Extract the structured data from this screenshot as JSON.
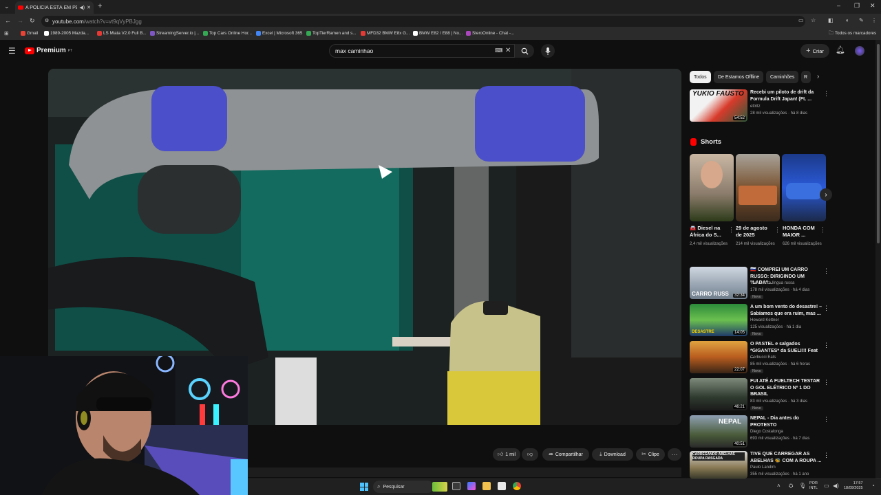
{
  "browser": {
    "tab_title": "A POLÍCIA ESTÁ EM PESO I",
    "url_host": "youtube.com",
    "url_path": "/watch?v=vt9qVyPBJgg",
    "bookmarks": [
      {
        "label": "Gmail",
        "color": "#ea4335"
      },
      {
        "label": "1989-2005 Mazda...",
        "color": "#ffffff"
      },
      {
        "label": "LS Miata V2.0 Full B...",
        "color": "#e53935"
      },
      {
        "label": "StreamingServer.io |...",
        "color": "#7e57c2"
      },
      {
        "label": "Top Cars Online Hor...",
        "color": "#34a853"
      },
      {
        "label": "Excel | Microsoft 365",
        "color": "#4285f4"
      },
      {
        "label": "TopTierRamen and s...",
        "color": "#34a853"
      },
      {
        "label": "MFD32 BMW E8x G...",
        "color": "#e53935"
      },
      {
        "label": "BMW E82 / E88 | No...",
        "color": "#ffffff"
      },
      {
        "label": "SteroOnline - Chat -...",
        "color": "#ab47bc"
      }
    ],
    "all_bookmarks": "Todos os marcadores"
  },
  "youtube": {
    "logo": "Premium",
    "logo_sup": "PT",
    "search_value": "max caminhao",
    "create_label": "Criar"
  },
  "actions": {
    "likes": "1 mil",
    "share": "Compartilhar",
    "download": "Download",
    "clip": "Clipe"
  },
  "chips": [
    "Todos",
    "De Estamos Offline",
    "Caminhões",
    "R"
  ],
  "top_video": {
    "title": "Recebi um piloto de drift da Formula Drift Japan! (Ft. ...",
    "channel": "ettritz",
    "meta": "28 mil visualizações · há 8 dias",
    "duration": "54:52",
    "thumb_text": "YUKIO FAUSTO"
  },
  "shorts": {
    "heading": "Shorts",
    "items": [
      {
        "title": "🚘 Diesel na África do S...",
        "views": "2,4 mil visualizações"
      },
      {
        "title": "29 de agosto de 2025",
        "views": "214 mil visualizações"
      },
      {
        "title": "HONDA COM MAIOR ...",
        "views": "626 mil visualizações"
      }
    ]
  },
  "videos": [
    {
      "title": "🇷🇺 COMPREI UM CARRO RUSSO: DIRIGINDO UM \"LADA\"...",
      "channel": "Vem a mim língua russa",
      "meta": "178 mil visualizações · há 4 dias",
      "badge": "Novo",
      "duration": "32:34",
      "thumb_text": "CARRO RUSS"
    },
    {
      "title": "A um bom vento do desastre! – Sabíamos que era ruim, mas ...",
      "channel": "Howard Kettner",
      "meta": "125 visualizações · há 1 dia",
      "badge": "Novo",
      "duration": "14:05",
      "thumb_text": "DESASTRE"
    },
    {
      "title": "O PASTEL e salgados *GIGANTES* da SUELI!!! Feat ...",
      "channel": "Corbucci Eats",
      "meta": "85 mil visualizações · há 6 horas",
      "badge": "Novo",
      "duration": "22:07",
      "thumb_text": ""
    },
    {
      "title": "FUI ATÉ A FUELTECH TESTAR O GOL ELÉTRICO Nº 1 DO BRASIL",
      "channel": "Reset",
      "meta": "83 mil visualizações · há 3 dias",
      "badge": "Novo",
      "duration": "46:21",
      "thumb_text": ""
    },
    {
      "title": "NEPAL - Dia antes do PROTESTO",
      "channel": "Diego Costalonga",
      "meta": "693 mil visualizações · há 7 dias",
      "badge": "",
      "duration": "40:51",
      "thumb_text": "NEPAL"
    },
    {
      "title": "TIVE QUE CARREGAR AS ABELHAS 🐝 COM A ROUPA ...",
      "channel": "Paulo Landim",
      "meta": "355 mil visualizações · há 1 ano",
      "badge": "",
      "duration": "",
      "thumb_text": "CARREGANDO ABELHAS ROUPA RASGADA"
    }
  ],
  "taskbar": {
    "search_placeholder": "Pesquisar",
    "lang_top": "POR",
    "lang_bottom": "INTL",
    "time": "17:57",
    "date": "18/09/2025"
  },
  "colors": {
    "accent": "#ff0000",
    "bg": "#0f0f0f"
  }
}
